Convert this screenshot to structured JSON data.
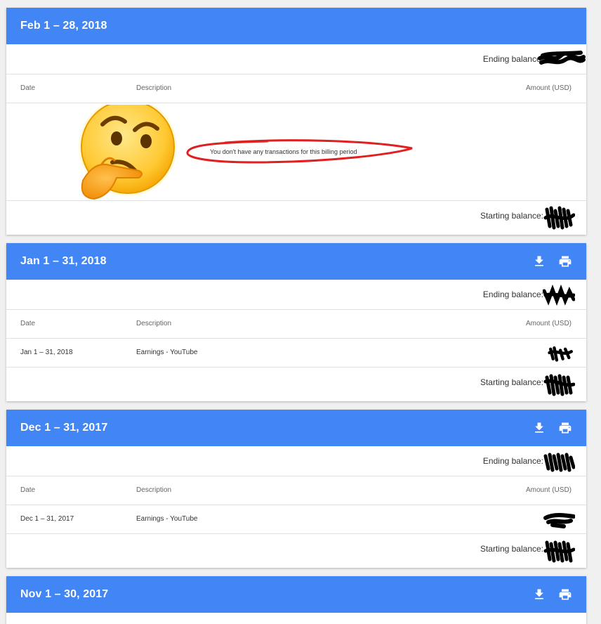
{
  "labels": {
    "ending_balance": "Ending balance:",
    "starting_balance": "Starting balance:",
    "col_date": "Date",
    "col_description": "Description",
    "col_amount": "Amount (USD)"
  },
  "icons": {
    "download": "download-icon",
    "print": "print-icon",
    "emoji": "thinking-face-icon"
  },
  "colors": {
    "header": "#4285f4",
    "annotation": "#e02020"
  },
  "statements": [
    {
      "period": "Feb 1 – 28, 2018",
      "empty_message": "You don't have any transactions for this billing period",
      "transactions": []
    },
    {
      "period": "Jan 1 – 31, 2018",
      "transactions": [
        {
          "date": "Jan 1 – 31, 2018",
          "description": "Earnings - YouTube"
        }
      ]
    },
    {
      "period": "Dec 1 – 31, 2017",
      "transactions": [
        {
          "date": "Dec 1 – 31, 2017",
          "description": "Earnings - YouTube"
        }
      ]
    },
    {
      "period": "Nov 1 – 30, 2017",
      "transactions": []
    }
  ]
}
